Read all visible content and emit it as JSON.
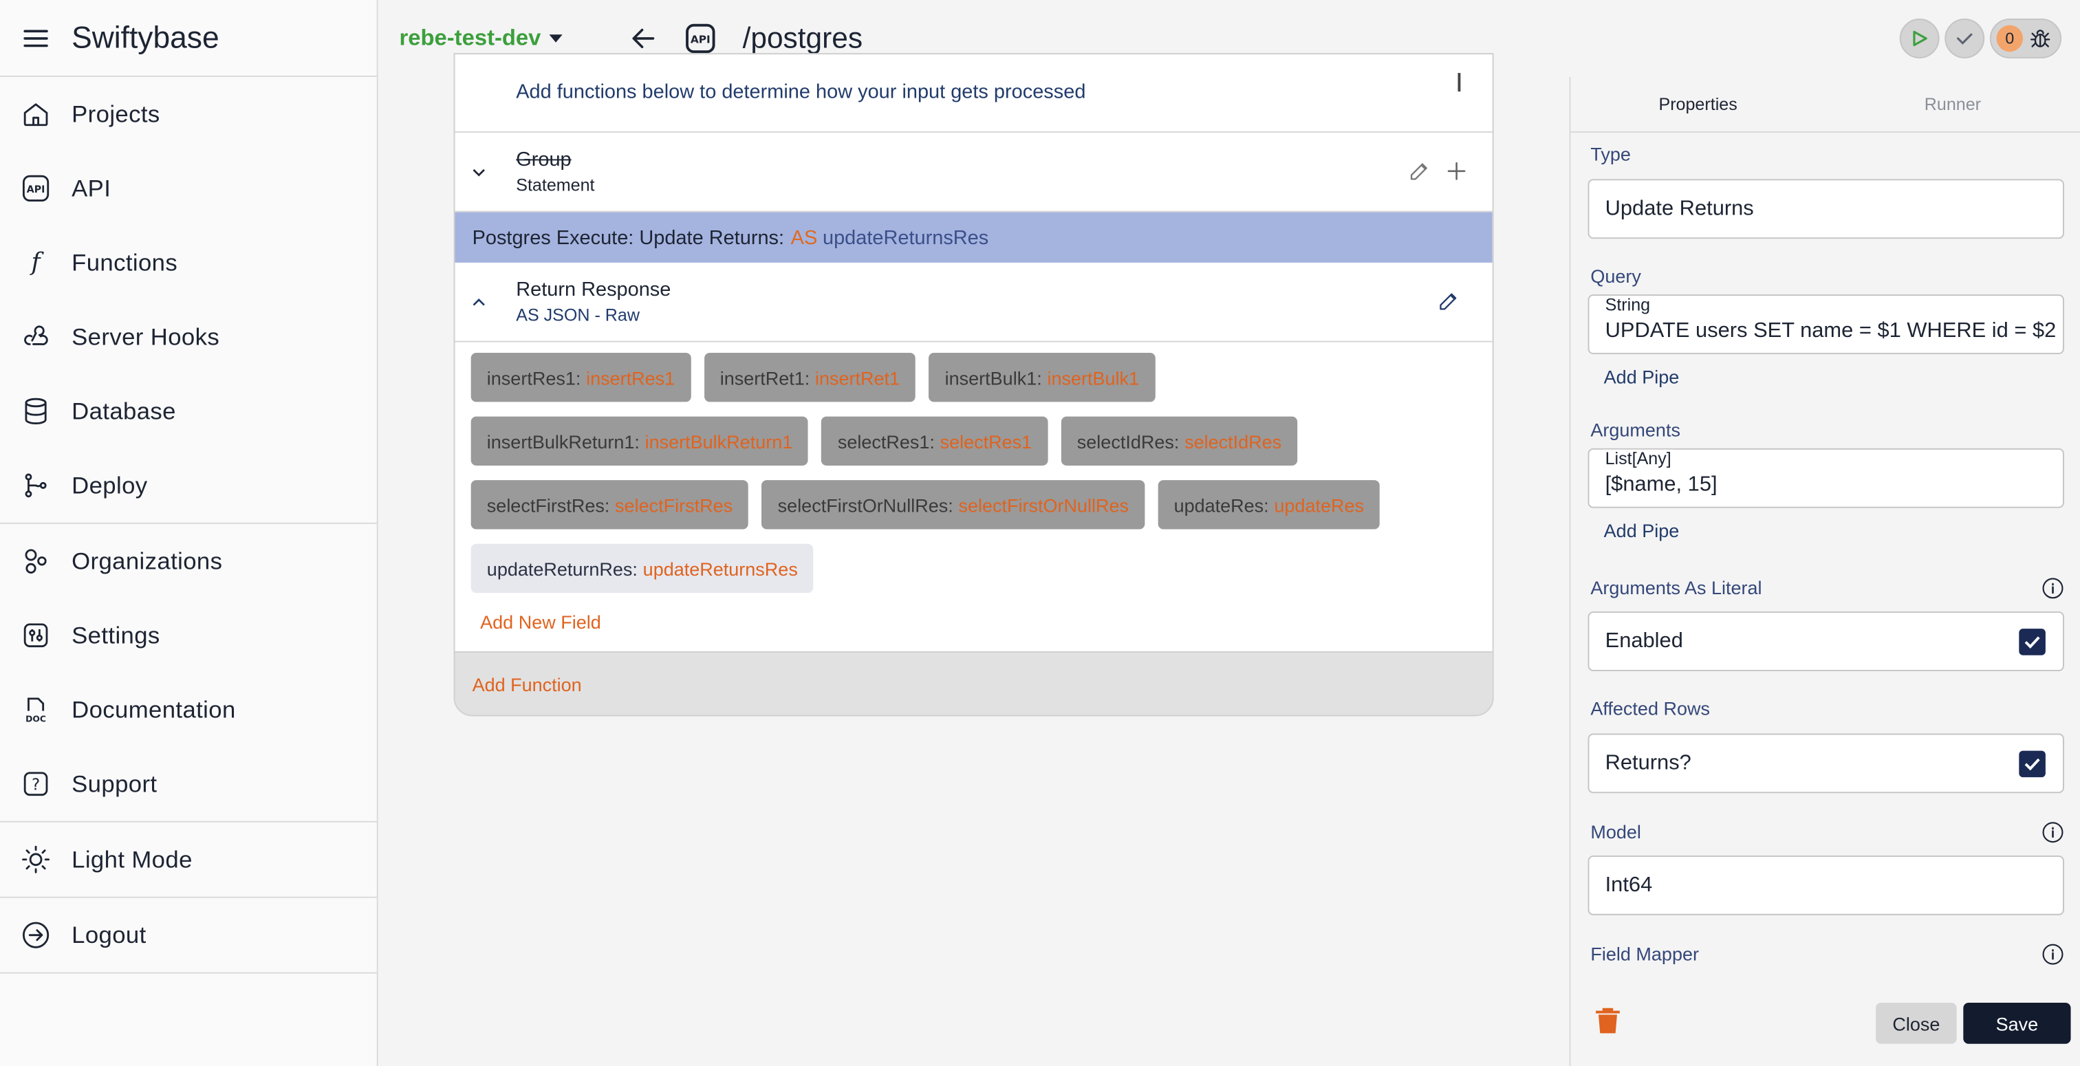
{
  "app": {
    "title": "Swiftybase"
  },
  "sidebar": {
    "groups": [
      [
        {
          "label": "Projects",
          "icon": "home-icon"
        },
        {
          "label": "API",
          "icon": "api-icon"
        },
        {
          "label": "Functions",
          "icon": "function-icon"
        },
        {
          "label": "Server Hooks",
          "icon": "webhook-icon"
        },
        {
          "label": "Database",
          "icon": "database-icon"
        },
        {
          "label": "Deploy",
          "icon": "git-branch-icon"
        }
      ],
      [
        {
          "label": "Organizations",
          "icon": "organizations-icon"
        },
        {
          "label": "Settings",
          "icon": "settings-icon"
        },
        {
          "label": "Documentation",
          "icon": "doc-icon"
        },
        {
          "label": "Support",
          "icon": "help-icon"
        }
      ],
      [
        {
          "label": "Light Mode",
          "icon": "sun-icon"
        }
      ],
      [
        {
          "label": "Logout",
          "icon": "logout-icon"
        }
      ]
    ]
  },
  "topbar": {
    "environment": "rebe-test-dev",
    "route": "/postgres",
    "api_badge": "API",
    "error_count": "0",
    "colors": {
      "env": "#3c9f3c"
    }
  },
  "editor": {
    "hint": "Add functions below to determine how your input gets processed",
    "group": {
      "title": "Group",
      "subtitle": "Statement"
    },
    "execute": {
      "prefix": "Postgres Execute: Update Returns:",
      "as": "AS",
      "var": "updateReturnsRes"
    },
    "response": {
      "title": "Return Response",
      "subtitle": "AS JSON - Raw"
    },
    "fields": [
      {
        "key": "insertRes1:",
        "value": "insertRes1",
        "style": "dark"
      },
      {
        "key": "insertRet1:",
        "value": "insertRet1",
        "style": "dark"
      },
      {
        "key": "insertBulk1:",
        "value": "insertBulk1",
        "style": "dark"
      },
      {
        "key": "insertBulkReturn1:",
        "value": "insertBulkReturn1",
        "style": "dark"
      },
      {
        "key": "selectRes1:",
        "value": "selectRes1",
        "style": "dark"
      },
      {
        "key": "selectIdRes:",
        "value": "selectIdRes",
        "style": "dark"
      },
      {
        "key": "selectFirstRes:",
        "value": "selectFirstRes",
        "style": "dark"
      },
      {
        "key": "selectFirstOrNullRes:",
        "value": "selectFirstOrNullRes",
        "style": "dark"
      },
      {
        "key": "updateRes:",
        "value": "updateRes",
        "style": "dark"
      },
      {
        "key": "updateReturnRes:",
        "value": "updateReturnsRes",
        "style": "light"
      }
    ],
    "add_field": "Add New Field",
    "add_function": "Add Function"
  },
  "panel": {
    "tabs": [
      "Properties",
      "Runner"
    ],
    "type": {
      "label": "Type",
      "value": "Update Returns"
    },
    "query": {
      "label": "Query",
      "legend": "String",
      "value": "UPDATE users SET name = $1 WHERE id = $2"
    },
    "arguments": {
      "label": "Arguments",
      "legend": "List[Any]",
      "value": "[$name, 15]"
    },
    "add_pipe": "Add Pipe",
    "args_literal": {
      "label": "Arguments As Literal",
      "value": "Enabled"
    },
    "affected_rows": {
      "label": "Affected Rows",
      "value": "Returns?"
    },
    "model": {
      "label": "Model",
      "value": "Int64"
    },
    "field_mapper": {
      "label": "Field Mapper"
    },
    "close": "Close",
    "save": "Save"
  }
}
